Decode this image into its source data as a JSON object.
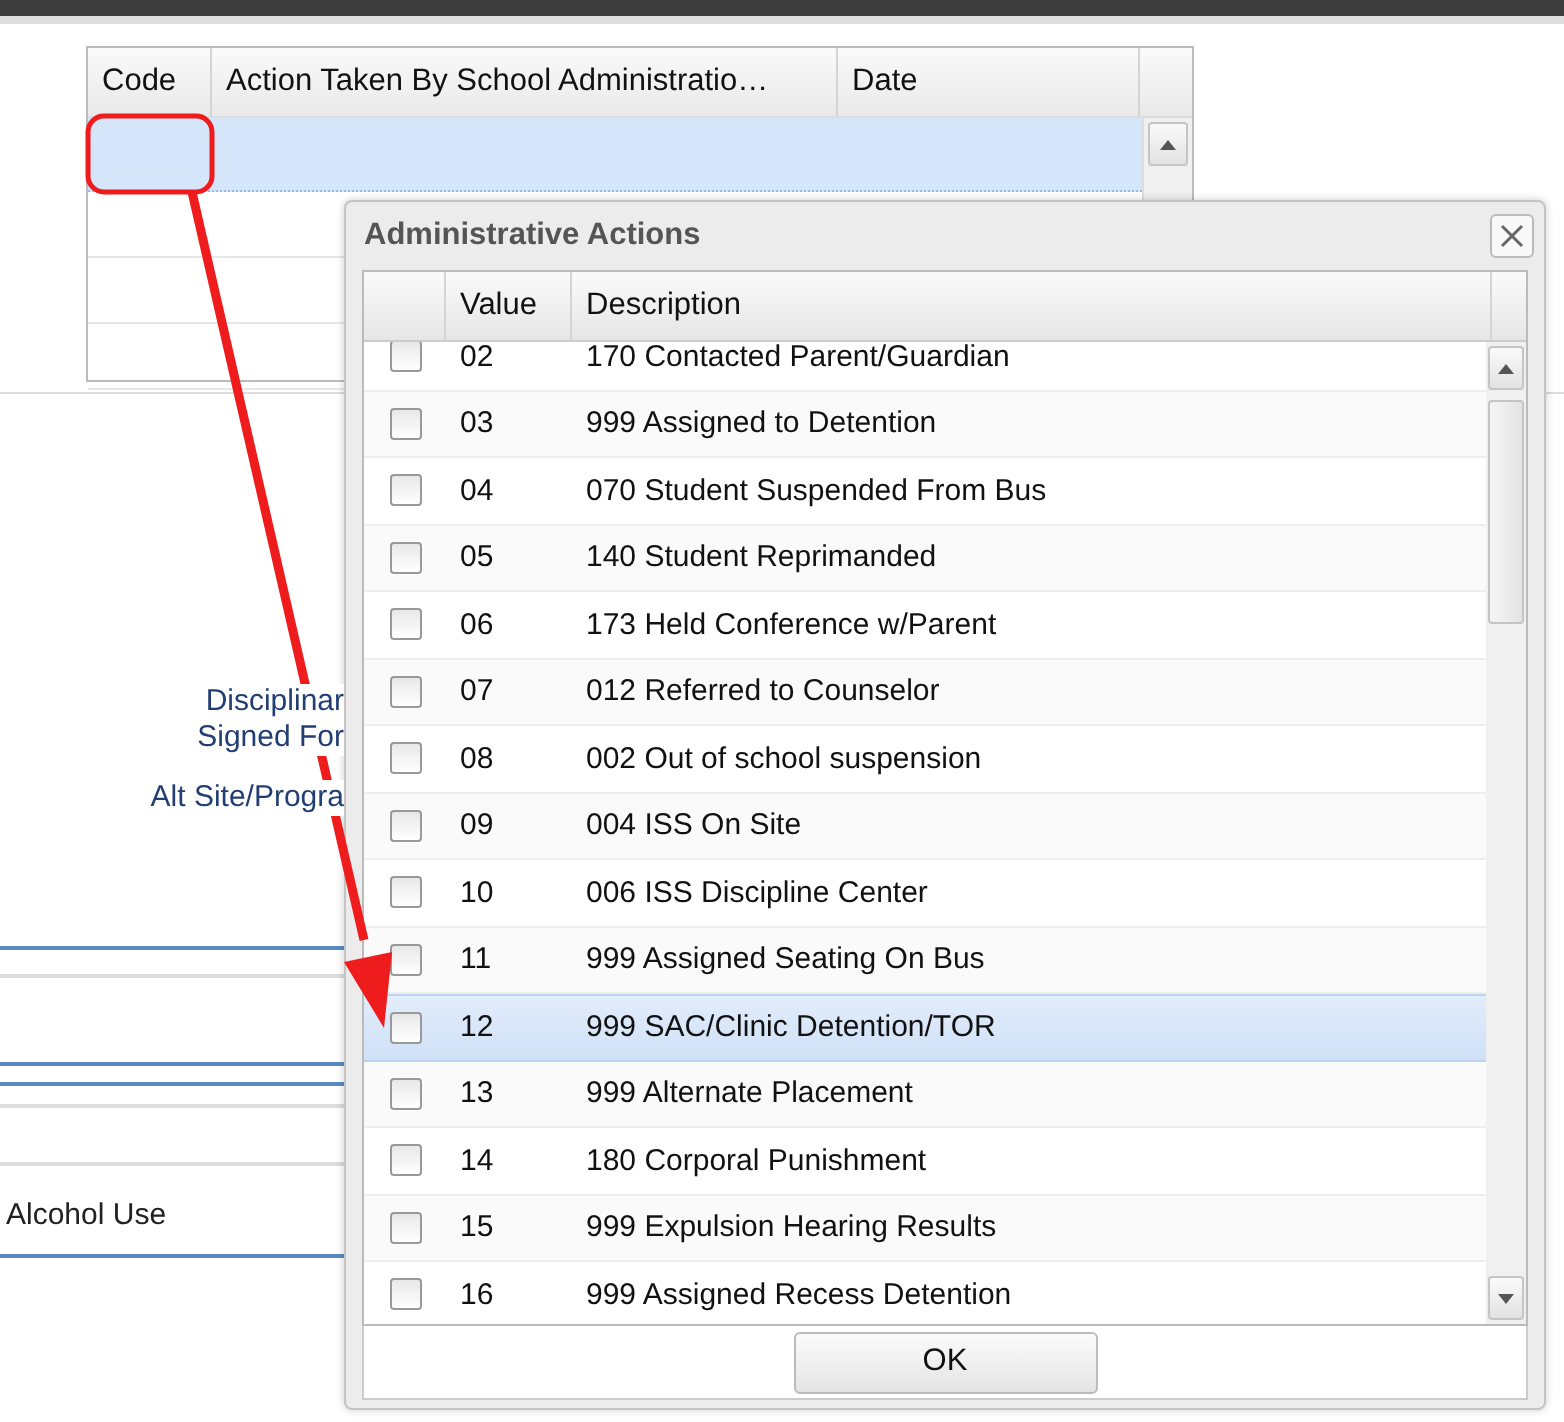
{
  "grid": {
    "columns": [
      "Code",
      "Action Taken By School Administratio…",
      "Date"
    ],
    "rows": [
      {
        "selected": true
      },
      {
        "selected": false
      },
      {
        "selected": false
      },
      {
        "selected": false
      }
    ]
  },
  "form": {
    "labels": [
      "Disciplinar",
      "Signed For",
      "Alt Site/Progra"
    ],
    "field_label": "Alcohol Use"
  },
  "dialog": {
    "title": "Administrative Actions",
    "columns": [
      "Value",
      "Description"
    ],
    "rows": [
      {
        "value": "02",
        "description": "170 Contacted Parent/Guardian",
        "checked": false,
        "selected": false
      },
      {
        "value": "03",
        "description": "999 Assigned to Detention",
        "checked": false,
        "selected": false
      },
      {
        "value": "04",
        "description": "070 Student Suspended From Bus",
        "checked": false,
        "selected": false
      },
      {
        "value": "05",
        "description": "140 Student Reprimanded",
        "checked": false,
        "selected": false
      },
      {
        "value": "06",
        "description": "173 Held Conference w/Parent",
        "checked": false,
        "selected": false
      },
      {
        "value": "07",
        "description": "012 Referred to Counselor",
        "checked": false,
        "selected": false
      },
      {
        "value": "08",
        "description": "002 Out of school suspension",
        "checked": false,
        "selected": false
      },
      {
        "value": "09",
        "description": "004 ISS On Site",
        "checked": false,
        "selected": false
      },
      {
        "value": "10",
        "description": "006 ISS Discipline Center",
        "checked": false,
        "selected": false
      },
      {
        "value": "11",
        "description": "999 Assigned Seating On Bus",
        "checked": false,
        "selected": false
      },
      {
        "value": "12",
        "description": "999 SAC/Clinic Detention/TOR",
        "checked": false,
        "selected": true
      },
      {
        "value": "13",
        "description": "999 Alternate Placement",
        "checked": false,
        "selected": false
      },
      {
        "value": "14",
        "description": "180 Corporal Punishment",
        "checked": false,
        "selected": false
      },
      {
        "value": "15",
        "description": "999 Expulsion Hearing Results",
        "checked": false,
        "selected": false
      },
      {
        "value": "16",
        "description": "999 Assigned Recess Detention",
        "checked": false,
        "selected": false
      }
    ],
    "ok_button": "OK"
  }
}
